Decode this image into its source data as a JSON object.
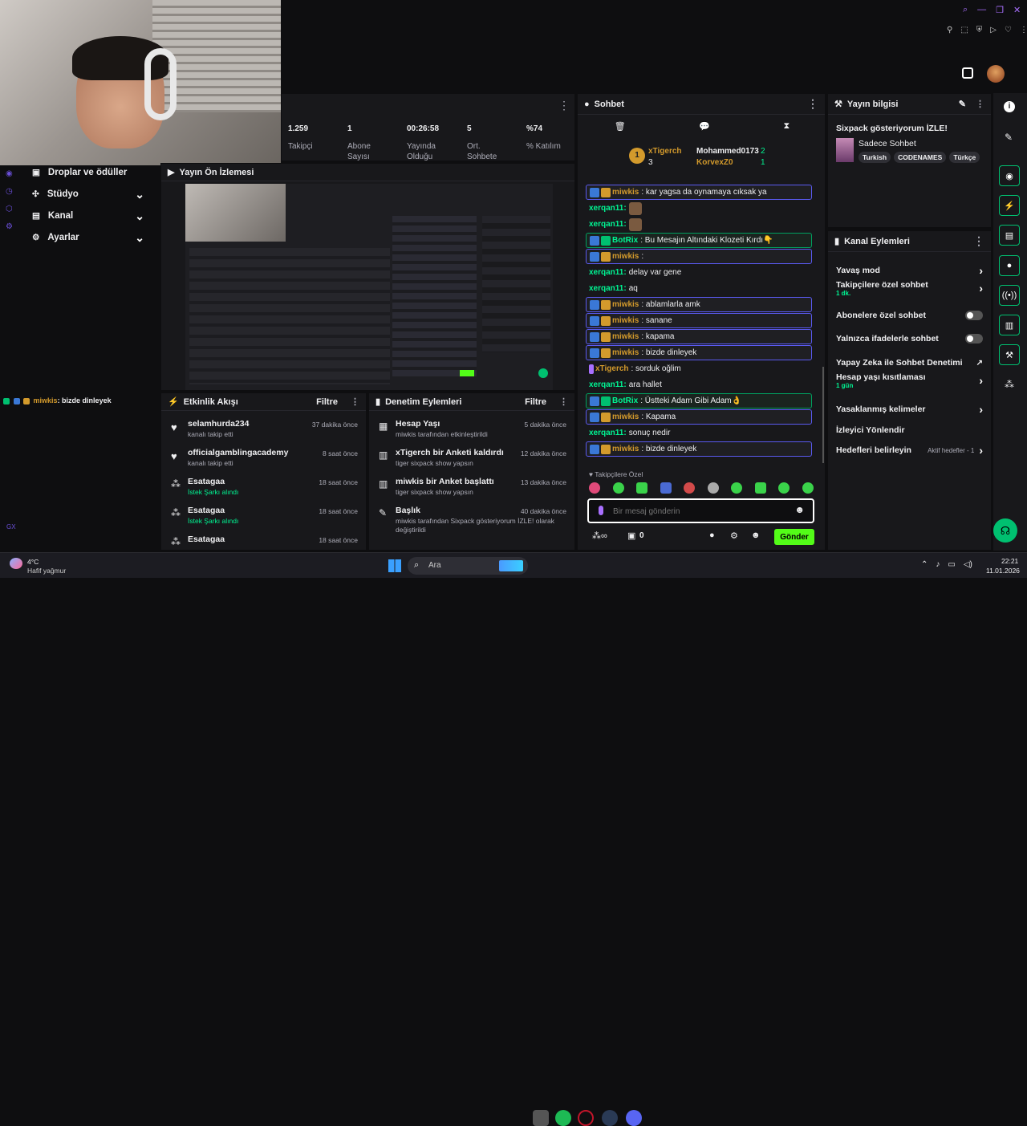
{
  "stats": [
    {
      "value": "1.259",
      "label": "Takipçi"
    },
    {
      "value": "1",
      "label": "Abone Sayısı"
    },
    {
      "value": "00:26:58",
      "label": "Yayında Olduğu"
    },
    {
      "value": "5",
      "label": "Ort. Sohbete"
    },
    {
      "value": "%74",
      "label": "% Katılım"
    }
  ],
  "sidebar": {
    "items": [
      {
        "label": "Droplar ve ödüller"
      },
      {
        "label": "Stüdyo"
      },
      {
        "label": "Kanal"
      },
      {
        "label": "Ayarlar"
      }
    ]
  },
  "preview": {
    "title": "Yayın Ön İzlemesi"
  },
  "overlay_chat": {
    "user": "miwkis",
    "text": ": bizde dinleyek"
  },
  "chat": {
    "title": "Sohbet",
    "top_chatters": [
      {
        "name": "xTigerch",
        "rank": "1",
        "count": "3"
      },
      {
        "name": "Mohammed0173",
        "count": "2"
      },
      {
        "name": "KorvexZ0",
        "count": "1"
      }
    ],
    "messages": [
      {
        "user": "miwkis",
        "text": ": kar yagsa da oynamaya cıksak ya",
        "style": "hl",
        "color": "#d39a2c"
      },
      {
        "user": "xerqan11:",
        "text": "",
        "style": "",
        "color": "#00f593"
      },
      {
        "user": "xerqan11:",
        "text": "",
        "style": "",
        "color": "#00f593"
      },
      {
        "user": "BotRix",
        "text": ": Bu Mesajın Altındaki Klozeti Kırdı👇",
        "style": "hl-green",
        "color": "#00f593"
      },
      {
        "user": "miwkis",
        "text": ":",
        "style": "hl",
        "color": "#d39a2c"
      },
      {
        "user": "xerqan11:",
        "text": "delay var gene",
        "style": "",
        "color": "#00f593"
      },
      {
        "user": "xerqan11:",
        "text": "aq",
        "style": "",
        "color": "#00f593"
      },
      {
        "user": "miwkis",
        "text": ": ablamlarla amk",
        "style": "hl",
        "color": "#d39a2c"
      },
      {
        "user": "miwkis",
        "text": ": sanane",
        "style": "hl",
        "color": "#d39a2c"
      },
      {
        "user": "miwkis",
        "text": ": kapama",
        "style": "hl",
        "color": "#d39a2c"
      },
      {
        "user": "miwkis",
        "text": ": bizde dinleyek",
        "style": "hl",
        "color": "#d39a2c"
      },
      {
        "user": "xTigerch",
        "text": ": sorduk oğlim",
        "style": "",
        "color": "#d39a2c"
      },
      {
        "user": "xerqan11:",
        "text": "ara hallet",
        "style": "",
        "color": "#00f593"
      },
      {
        "user": "BotRix",
        "text": ": Üstteki Adam Gibi Adam👌",
        "style": "hl-green",
        "color": "#00f593"
      },
      {
        "user": "miwkis",
        "text": ": Kapama",
        "style": "hl",
        "color": "#d39a2c"
      },
      {
        "user": "xerqan11:",
        "text": "sonuç nedir",
        "style": "",
        "color": "#00f593"
      },
      {
        "user": "miwkis",
        "text": ": bizde dinleyek",
        "style": "hl",
        "color": "#d39a2c"
      }
    ],
    "followers_only": "Takipçilere Özel",
    "input_placeholder": "Bir mesaj gönderin",
    "points": "0",
    "send_label": "Gönder"
  },
  "stream_info": {
    "title": "Yayın bilgisi",
    "stream_title": "Sixpack gösteriyorum İZLE!",
    "category": "Sadece Sohbet",
    "tags": [
      "Turkish",
      "CODENAMES",
      "Türkçe"
    ]
  },
  "channel_actions": {
    "title": "Kanal Eylemleri",
    "items": [
      {
        "label": "Yavaş mod",
        "sub": "",
        "control": "chevron"
      },
      {
        "label": "Takipçilere özel sohbet",
        "sub": "1 dk.",
        "control": "chevron"
      },
      {
        "label": "Abonelere özel sohbet",
        "sub": "",
        "control": "toggle"
      },
      {
        "label": "Yalnızca ifadelerle sohbet",
        "sub": "",
        "control": "toggle"
      },
      {
        "label": "Yapay Zeka ile Sohbet Denetimi",
        "sub": "",
        "control": "external"
      },
      {
        "label": "Hesap yaşı kısıtlaması",
        "sub": "1 gün",
        "control": "chevron"
      },
      {
        "label": "Yasaklanmış kelimeler",
        "sub": "",
        "control": "chevron"
      },
      {
        "label": "İzleyici Yönlendir",
        "sub": "",
        "control": "none"
      },
      {
        "label": "Hedefleri belirleyin",
        "sub": "",
        "control": "chevron",
        "extra": "Aktif hedefler - 1"
      }
    ]
  },
  "activity": {
    "title": "Etkinlik Akışı",
    "filter": "Filtre",
    "items": [
      {
        "user": "selamhurda234",
        "detail": "kanalı takip etti",
        "time": "37 dakika önce",
        "icon": "heart-icon"
      },
      {
        "user": "officialgamblingacademy",
        "detail": "kanalı takip etti",
        "time": "8 saat önce",
        "icon": "heart-icon"
      },
      {
        "user": "Esatagaa",
        "detail": "İstek Şarkı alındı",
        "time": "18 saat önce",
        "icon": "points-icon"
      },
      {
        "user": "Esatagaa",
        "detail": "İstek Şarkı alındı",
        "time": "18 saat önce",
        "icon": "points-icon"
      },
      {
        "user": "Esatagaa",
        "detail": "",
        "time": "18 saat önce",
        "icon": "points-icon"
      }
    ]
  },
  "moderation": {
    "title": "Denetim Eylemleri",
    "filter": "Filtre",
    "items": [
      {
        "title": "Hesap Yaşı",
        "detail": "miwkis tarafından etkinleştirildi",
        "time": "5 dakika önce"
      },
      {
        "title": "xTigerch bir Anketi kaldırdı",
        "detail": "tiger sixpack show yapsın",
        "time": "12 dakika önce"
      },
      {
        "title": "miwkis bir Anket başlattı",
        "detail": "tiger sixpack show yapsın",
        "time": "13 dakika önce"
      },
      {
        "title": "Başlık",
        "detail": "miwkis tarafından Sixpack gösteriyorum İZLE! olarak değiştirildi",
        "time": "40 dakika önce"
      }
    ]
  },
  "taskbar": {
    "weather_temp": "4°C",
    "weather_desc": "Hafif yağmur",
    "search": "Ara",
    "time": "22:21",
    "date": "11.01.2026"
  },
  "side_label": "GX",
  "colors": {
    "accent": "#53fc18",
    "green": "#00f593",
    "bg": "#0e0e10",
    "panel": "#18181b"
  }
}
